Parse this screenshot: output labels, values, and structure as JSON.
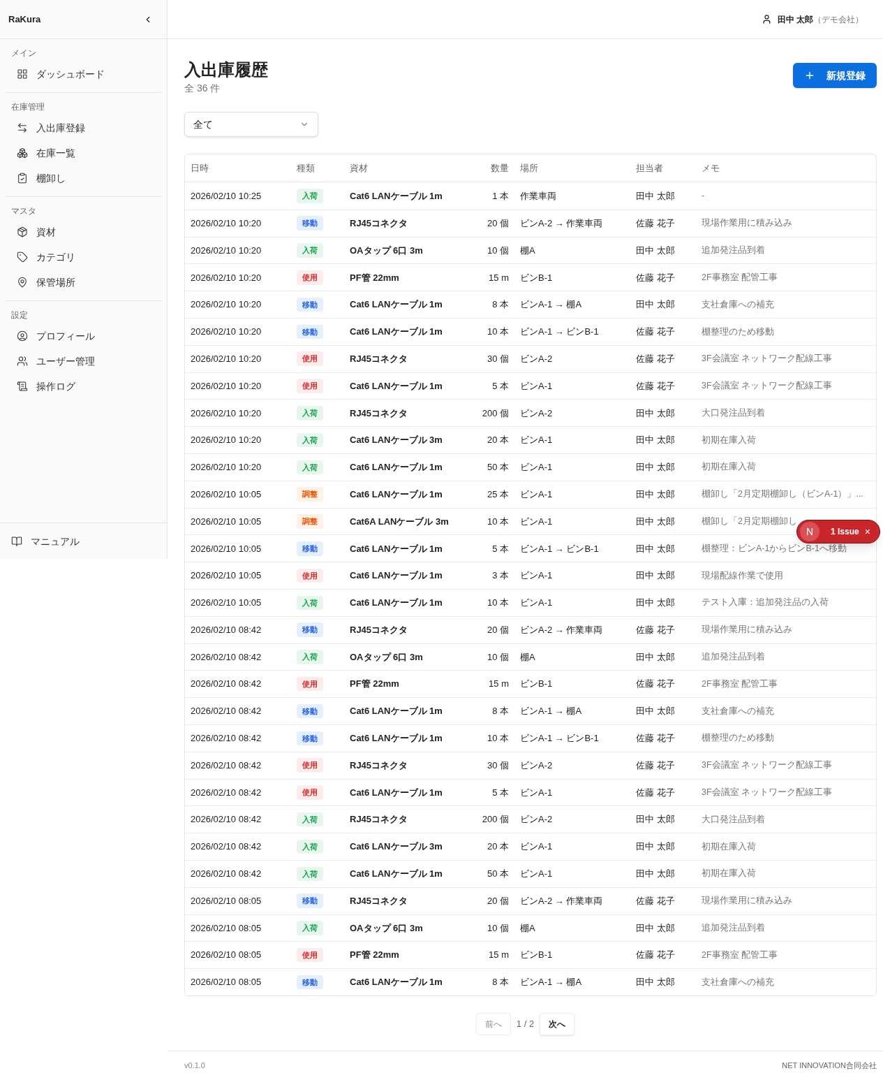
{
  "sidebar": {
    "brand": "RaKura",
    "sections": [
      {
        "title": "メイン",
        "items": [
          {
            "label": "ダッシュボード"
          }
        ]
      },
      {
        "title": "在庫管理",
        "items": [
          {
            "label": "入出庫登録"
          },
          {
            "label": "在庫一覧"
          },
          {
            "label": "棚卸し"
          }
        ]
      },
      {
        "title": "マスタ",
        "items": [
          {
            "label": "資材"
          },
          {
            "label": "カテゴリ"
          },
          {
            "label": "保管場所"
          }
        ]
      },
      {
        "title": "設定",
        "items": [
          {
            "label": "プロフィール"
          },
          {
            "label": "ユーザー管理"
          },
          {
            "label": "操作ログ"
          }
        ]
      }
    ],
    "footer_item": {
      "label": "マニュアル"
    }
  },
  "header": {
    "user_name": "田中 太郎",
    "company": "（デモ会社）"
  },
  "page": {
    "title": "入出庫履歴",
    "count": "全 36 件",
    "new_button": "新規登録",
    "filter": "全て"
  },
  "table": {
    "columns": [
      "日時",
      "種類",
      "資材",
      "数量",
      "場所",
      "担当者",
      "メモ"
    ],
    "rows": [
      {
        "date": "2026/02/10 10:25",
        "kind": "in",
        "type": "入荷",
        "material": "Cat6 LANケーブル 1m",
        "qty": "1 本",
        "location": "作業車両",
        "person": "田中 太郎",
        "memo": "-"
      },
      {
        "date": "2026/02/10 10:20",
        "kind": "move",
        "type": "移動",
        "material": "RJ45コネクタ",
        "qty": "20 個",
        "location": "ビンA-2 → 作業車両",
        "person": "佐藤 花子",
        "memo": "現場作業用に積み込み"
      },
      {
        "date": "2026/02/10 10:20",
        "kind": "in",
        "type": "入荷",
        "material": "OAタップ 6口 3m",
        "qty": "10 個",
        "location": "棚A",
        "person": "田中 太郎",
        "memo": "追加発注品到着"
      },
      {
        "date": "2026/02/10 10:20",
        "kind": "use",
        "type": "使用",
        "material": "PF管 22mm",
        "qty": "15 m",
        "location": "ビンB-1",
        "person": "佐藤 花子",
        "memo": "2F事務室 配管工事"
      },
      {
        "date": "2026/02/10 10:20",
        "kind": "move",
        "type": "移動",
        "material": "Cat6 LANケーブル 1m",
        "qty": "8 本",
        "location": "ビンA-1 → 棚A",
        "person": "田中 太郎",
        "memo": "支社倉庫への補充"
      },
      {
        "date": "2026/02/10 10:20",
        "kind": "move",
        "type": "移動",
        "material": "Cat6 LANケーブル 1m",
        "qty": "10 本",
        "location": "ビンA-1 → ビンB-1",
        "person": "佐藤 花子",
        "memo": "棚整理のため移動"
      },
      {
        "date": "2026/02/10 10:20",
        "kind": "use",
        "type": "使用",
        "material": "RJ45コネクタ",
        "qty": "30 個",
        "location": "ビンA-2",
        "person": "佐藤 花子",
        "memo": "3F会議室 ネットワーク配線工事"
      },
      {
        "date": "2026/02/10 10:20",
        "kind": "use",
        "type": "使用",
        "material": "Cat6 LANケーブル 1m",
        "qty": "5 本",
        "location": "ビンA-1",
        "person": "佐藤 花子",
        "memo": "3F会議室 ネットワーク配線工事"
      },
      {
        "date": "2026/02/10 10:20",
        "kind": "in",
        "type": "入荷",
        "material": "RJ45コネクタ",
        "qty": "200 個",
        "location": "ビンA-2",
        "person": "田中 太郎",
        "memo": "大口発注品到着"
      },
      {
        "date": "2026/02/10 10:20",
        "kind": "in",
        "type": "入荷",
        "material": "Cat6 LANケーブル 3m",
        "qty": "20 本",
        "location": "ビンA-1",
        "person": "田中 太郎",
        "memo": "初期在庫入荷"
      },
      {
        "date": "2026/02/10 10:20",
        "kind": "in",
        "type": "入荷",
        "material": "Cat6 LANケーブル 1m",
        "qty": "50 本",
        "location": "ビンA-1",
        "person": "田中 太郎",
        "memo": "初期在庫入荷"
      },
      {
        "date": "2026/02/10 10:05",
        "kind": "adjust",
        "type": "調整",
        "material": "Cat6 LANケーブル 1m",
        "qty": "25 本",
        "location": "ビンA-1",
        "person": "田中 太郎",
        "memo": "棚卸し「2月定期棚卸し（ビンA-1）」..."
      },
      {
        "date": "2026/02/10 10:05",
        "kind": "adjust",
        "type": "調整",
        "material": "Cat6A LANケーブル 3m",
        "qty": "10 本",
        "location": "ビンA-1",
        "person": "田中 太郎",
        "memo": "棚卸し「2月定期棚卸し"
      },
      {
        "date": "2026/02/10 10:05",
        "kind": "move",
        "type": "移動",
        "material": "Cat6 LANケーブル 1m",
        "qty": "5 本",
        "location": "ビンA-1 → ビンB-1",
        "person": "田中 太郎",
        "memo": "棚整理：ビンA-1からビンB-1へ移動"
      },
      {
        "date": "2026/02/10 10:05",
        "kind": "use",
        "type": "使用",
        "material": "Cat6 LANケーブル 1m",
        "qty": "3 本",
        "location": "ビンA-1",
        "person": "田中 太郎",
        "memo": "現場配線作業で使用"
      },
      {
        "date": "2026/02/10 10:05",
        "kind": "in",
        "type": "入荷",
        "material": "Cat6 LANケーブル 1m",
        "qty": "10 本",
        "location": "ビンA-1",
        "person": "田中 太郎",
        "memo": "テスト入庫：追加発注品の入荷"
      },
      {
        "date": "2026/02/10 08:42",
        "kind": "move",
        "type": "移動",
        "material": "RJ45コネクタ",
        "qty": "20 個",
        "location": "ビンA-2 → 作業車両",
        "person": "佐藤 花子",
        "memo": "現場作業用に積み込み"
      },
      {
        "date": "2026/02/10 08:42",
        "kind": "in",
        "type": "入荷",
        "material": "OAタップ 6口 3m",
        "qty": "10 個",
        "location": "棚A",
        "person": "田中 太郎",
        "memo": "追加発注品到着"
      },
      {
        "date": "2026/02/10 08:42",
        "kind": "use",
        "type": "使用",
        "material": "PF管 22mm",
        "qty": "15 m",
        "location": "ビンB-1",
        "person": "佐藤 花子",
        "memo": "2F事務室 配管工事"
      },
      {
        "date": "2026/02/10 08:42",
        "kind": "move",
        "type": "移動",
        "material": "Cat6 LANケーブル 1m",
        "qty": "8 本",
        "location": "ビンA-1 → 棚A",
        "person": "田中 太郎",
        "memo": "支社倉庫への補充"
      },
      {
        "date": "2026/02/10 08:42",
        "kind": "move",
        "type": "移動",
        "material": "Cat6 LANケーブル 1m",
        "qty": "10 本",
        "location": "ビンA-1 → ビンB-1",
        "person": "佐藤 花子",
        "memo": "棚整理のため移動"
      },
      {
        "date": "2026/02/10 08:42",
        "kind": "use",
        "type": "使用",
        "material": "RJ45コネクタ",
        "qty": "30 個",
        "location": "ビンA-2",
        "person": "佐藤 花子",
        "memo": "3F会議室 ネットワーク配線工事"
      },
      {
        "date": "2026/02/10 08:42",
        "kind": "use",
        "type": "使用",
        "material": "Cat6 LANケーブル 1m",
        "qty": "5 本",
        "location": "ビンA-1",
        "person": "佐藤 花子",
        "memo": "3F会議室 ネットワーク配線工事"
      },
      {
        "date": "2026/02/10 08:42",
        "kind": "in",
        "type": "入荷",
        "material": "RJ45コネクタ",
        "qty": "200 個",
        "location": "ビンA-2",
        "person": "田中 太郎",
        "memo": "大口発注品到着"
      },
      {
        "date": "2026/02/10 08:42",
        "kind": "in",
        "type": "入荷",
        "material": "Cat6 LANケーブル 3m",
        "qty": "20 本",
        "location": "ビンA-1",
        "person": "田中 太郎",
        "memo": "初期在庫入荷"
      },
      {
        "date": "2026/02/10 08:42",
        "kind": "in",
        "type": "入荷",
        "material": "Cat6 LANケーブル 1m",
        "qty": "50 本",
        "location": "ビンA-1",
        "person": "田中 太郎",
        "memo": "初期在庫入荷"
      },
      {
        "date": "2026/02/10 08:05",
        "kind": "move",
        "type": "移動",
        "material": "RJ45コネクタ",
        "qty": "20 個",
        "location": "ビンA-2 → 作業車両",
        "person": "佐藤 花子",
        "memo": "現場作業用に積み込み"
      },
      {
        "date": "2026/02/10 08:05",
        "kind": "in",
        "type": "入荷",
        "material": "OAタップ 6口 3m",
        "qty": "10 個",
        "location": "棚A",
        "person": "田中 太郎",
        "memo": "追加発注品到着"
      },
      {
        "date": "2026/02/10 08:05",
        "kind": "use",
        "type": "使用",
        "material": "PF管 22mm",
        "qty": "15 m",
        "location": "ビンB-1",
        "person": "佐藤 花子",
        "memo": "2F事務室 配管工事"
      },
      {
        "date": "2026/02/10 08:05",
        "kind": "move",
        "type": "移動",
        "material": "Cat6 LANケーブル 1m",
        "qty": "8 本",
        "location": "ビンA-1 → 棚A",
        "person": "田中 太郎",
        "memo": "支社倉庫への補充"
      }
    ]
  },
  "pagination": {
    "prev": "前へ",
    "page": "1 / 2",
    "next": "次へ",
    "prev_disabled": true
  },
  "footer": {
    "version": "v0.1.0",
    "company": "NET INNOVATION合同会社"
  },
  "issue_badge": {
    "letter": "N",
    "label": "1 Issue",
    "close": "×"
  }
}
